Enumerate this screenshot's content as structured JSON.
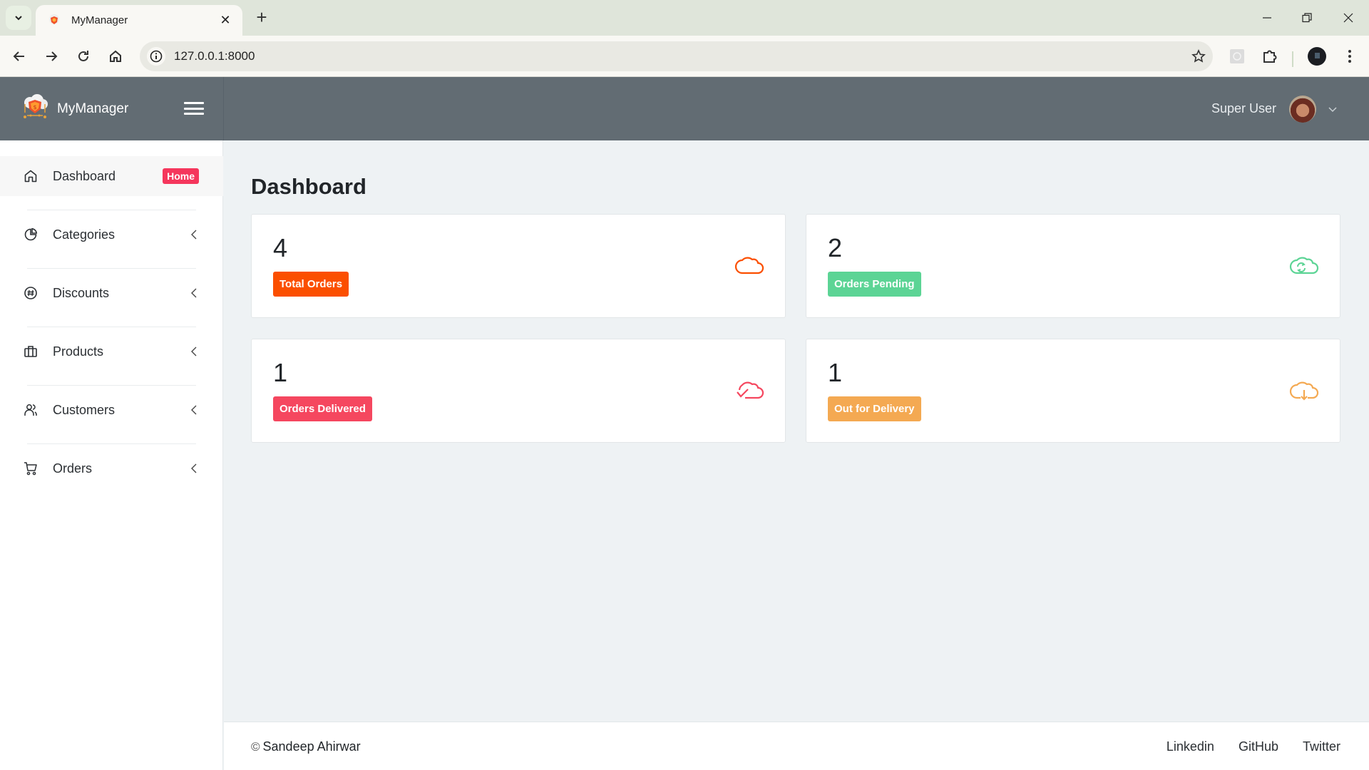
{
  "browser": {
    "tab_title": "MyManager",
    "url": "127.0.0.1:8000"
  },
  "header": {
    "brand": "MyManager",
    "user_name": "Super User"
  },
  "sidebar": {
    "items": [
      {
        "label": "Dashboard",
        "icon": "home-icon",
        "badge": "Home",
        "active": true
      },
      {
        "label": "Categories",
        "icon": "pie-chart-icon",
        "expandable": true
      },
      {
        "label": "Discounts",
        "icon": "discount-badge-icon",
        "expandable": true
      },
      {
        "label": "Products",
        "icon": "briefcase-icon",
        "expandable": true
      },
      {
        "label": "Customers",
        "icon": "users-icon",
        "expandable": true
      },
      {
        "label": "Orders",
        "icon": "cart-icon",
        "expandable": true
      }
    ]
  },
  "main": {
    "title": "Dashboard",
    "cards": [
      {
        "count": "4",
        "label": "Total Orders",
        "color": "#fb4f00",
        "icon": "cloud-icon"
      },
      {
        "count": "2",
        "label": "Orders Pending",
        "color": "#5cd495",
        "icon": "cloud-sync-icon"
      },
      {
        "count": "1",
        "label": "Orders Delivered",
        "color": "#f5475f",
        "icon": "cloud-check-icon"
      },
      {
        "count": "1",
        "label": "Out for Delivery",
        "color": "#f4a952",
        "icon": "cloud-download-icon"
      }
    ]
  },
  "footer": {
    "copyright_symbol": "©",
    "copyright": "Sandeep Ahirwar",
    "links": [
      "Linkedin",
      "GitHub",
      "Twitter"
    ]
  }
}
